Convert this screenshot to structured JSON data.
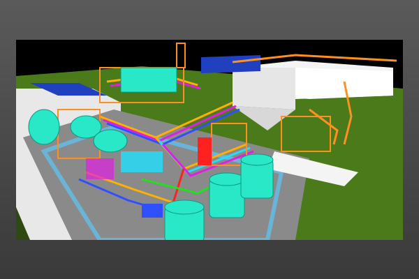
{
  "scene": {
    "description_visible_text": "",
    "colors": {
      "background": "#000000",
      "ground": "#4a7a1a",
      "slab": "#d8d8d8",
      "pad": "#8a8a8a",
      "curb_blue": "#6ab4d8",
      "tank": "#28e8c8",
      "pipe_yellow": "#ffb000",
      "pipe_magenta": "#e020e0",
      "pipe_blue": "#3050ff",
      "pipe_red": "#ff2020",
      "pipe_green": "#20e020",
      "pipe_cyan": "#20e0ff",
      "building_white": "#f4f4f4",
      "building_roof_blue": "#2040c0",
      "steel_orange": "#ff9020"
    }
  }
}
